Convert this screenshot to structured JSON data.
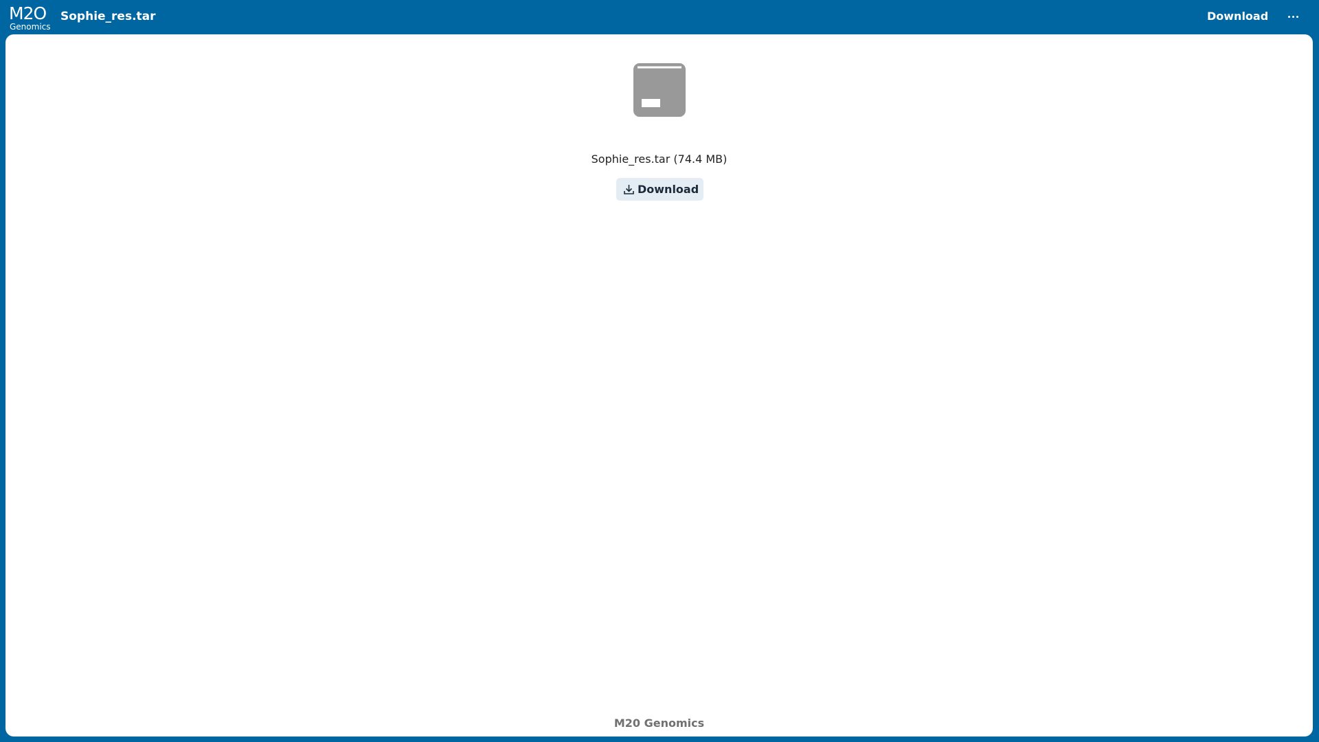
{
  "brand": {
    "logo_mark": "M2O",
    "logo_sub": "Genomics",
    "accent_color": "#0066a1"
  },
  "header": {
    "title": "Sophie_res.tar",
    "download_label": "Download",
    "more_icon": "more-horizontal-icon"
  },
  "file": {
    "icon": "archive-box-icon",
    "name_and_size": "Sophie_res.tar (74.4 MB)",
    "download_label": "Download",
    "download_icon": "download-icon"
  },
  "footer": {
    "text": "M20 Genomics"
  }
}
